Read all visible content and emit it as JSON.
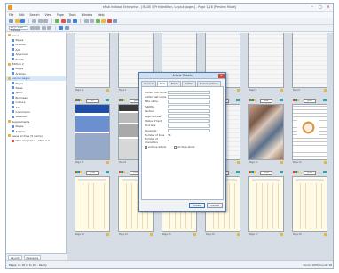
{
  "window": {
    "title": "ePub Inkbook Enterprise - [ISSUE 5 Print edition, Layout pages] - Page 1/16 [Preview Mode]"
  },
  "menu": [
    "File",
    "Edit",
    "Search",
    "View",
    "Page",
    "Tools",
    "Window",
    "Help"
  ],
  "toolbar2": {
    "combo_value": "Page 1/16 - Preview"
  },
  "tree": [
    {
      "level": 0,
      "label": "Issue",
      "icon": "folder",
      "hl": false
    },
    {
      "level": 1,
      "label": "Pages",
      "icon": "doc",
      "hl": false
    },
    {
      "level": 1,
      "label": "Articles",
      "icon": "doc",
      "hl": false
    },
    {
      "level": 1,
      "label": "Ads",
      "icon": "doc",
      "hl": false
    },
    {
      "level": 1,
      "label": "Approved",
      "icon": "doc",
      "hl": false
    },
    {
      "level": 1,
      "label": "Proofs",
      "icon": "doc",
      "hl": false
    },
    {
      "level": 0,
      "label": "Edition 2",
      "icon": "folder",
      "hl": false
    },
    {
      "level": 1,
      "label": "Pages",
      "icon": "doc",
      "hl": false
    },
    {
      "level": 1,
      "label": "Articles",
      "icon": "doc",
      "hl": false
    },
    {
      "level": 0,
      "label": "Layout pages",
      "icon": "folder",
      "hl": true
    },
    {
      "level": 1,
      "label": "Pages",
      "icon": "doc",
      "hl": false
    },
    {
      "level": 1,
      "label": "News",
      "icon": "doc",
      "hl": false
    },
    {
      "level": 1,
      "label": "Sport",
      "icon": "doc",
      "hl": false
    },
    {
      "level": 1,
      "label": "Business",
      "icon": "doc",
      "hl": false
    },
    {
      "level": 1,
      "label": "Culture",
      "icon": "doc",
      "hl": false
    },
    {
      "level": 1,
      "label": "Ads",
      "icon": "doc",
      "hl": false
    },
    {
      "level": 1,
      "label": "Comments",
      "icon": "doc",
      "hl": false
    },
    {
      "level": 1,
      "label": "Weather",
      "icon": "doc",
      "hl": false
    },
    {
      "level": 0,
      "label": "Supplements",
      "icon": "folder",
      "hl": false
    },
    {
      "level": 1,
      "label": "Pages",
      "icon": "doc",
      "hl": false
    },
    {
      "level": 1,
      "label": "Articles",
      "icon": "doc",
      "hl": false
    },
    {
      "level": 0,
      "label": "Issue archive (5 items)",
      "icon": "folder",
      "hl": false
    },
    {
      "level": 1,
      "label": "Web magazine - ePub 2.0",
      "icon": "red",
      "hl": false
    }
  ],
  "leftpanel_tabs": [
    "Layout",
    "Messages"
  ],
  "pages": [
    {
      "col": 0,
      "row": 0,
      "label": "p1",
      "style": "gray",
      "foot": "Page 1"
    },
    {
      "col": 1,
      "row": 0,
      "label": "p2",
      "style": "gray",
      "foot": "Page 2"
    },
    {
      "col": 2,
      "row": 0,
      "label": "p3",
      "style": "gray",
      "foot": "Page 3"
    },
    {
      "col": 3,
      "row": 0,
      "label": "p4",
      "style": "gray",
      "foot": "Page 4"
    },
    {
      "col": 4,
      "row": 0,
      "label": "p5",
      "style": "gray",
      "foot": "Page 5"
    },
    {
      "col": 5,
      "row": 0,
      "label": "p6",
      "style": "gray",
      "foot": "Page 6"
    },
    {
      "col": 0,
      "row": 1,
      "label": "p7",
      "style": "blue",
      "foot": "Page 7"
    },
    {
      "col": 1,
      "row": 1,
      "label": "p8",
      "style": "news",
      "foot": "Page 8"
    },
    {
      "col": 2,
      "row": 1,
      "label": "p9",
      "style": "gray",
      "foot": "Page 9"
    },
    {
      "col": 3,
      "row": 1,
      "label": "p10",
      "style": "gray",
      "foot": "Page 10"
    },
    {
      "col": 4,
      "row": 1,
      "label": "p11",
      "style": "photo",
      "foot": "Page 11"
    },
    {
      "col": 5,
      "row": 1,
      "label": "p12",
      "style": "paper",
      "foot": "Page 12"
    },
    {
      "col": 0,
      "row": 2,
      "label": "p13",
      "style": "cream",
      "foot": "Page 13"
    },
    {
      "col": 1,
      "row": 2,
      "label": "p14",
      "style": "cream",
      "foot": "Page 14"
    },
    {
      "col": 2,
      "row": 2,
      "label": "p15",
      "style": "cream",
      "foot": "Page 15"
    },
    {
      "col": 3,
      "row": 2,
      "label": "p16",
      "style": "cream",
      "foot": "Page 16"
    },
    {
      "col": 4,
      "row": 2,
      "label": "p17",
      "style": "cream",
      "foot": "Page 17"
    },
    {
      "col": 5,
      "row": 2,
      "label": "p18",
      "style": "cream",
      "foot": "Page 18"
    }
  ],
  "dialog": {
    "title": "Article Details",
    "tabs": [
      "General",
      "Text",
      "Notes",
      "Profiles",
      "Picture options"
    ],
    "active_tab": 1,
    "fields": [
      {
        "label": "Author first name",
        "type": "input",
        "value": ""
      },
      {
        "label": "Author last name",
        "type": "input",
        "value": ""
      },
      {
        "label": "Title name",
        "type": "input",
        "value": ""
      },
      {
        "label": "Subtitle",
        "type": "input",
        "value": ""
      },
      {
        "label": "Section",
        "type": "input",
        "value": ""
      },
      {
        "label": "Page number",
        "type": "select",
        "value": ""
      },
      {
        "label": "Status of text",
        "type": "select",
        "value": ""
      },
      {
        "label": "Font size",
        "type": "select",
        "value": ""
      },
      {
        "label": "Keywords",
        "type": "input",
        "value": ""
      },
      {
        "label": "Number of lines",
        "type": "text",
        "value": "34"
      },
      {
        "label": "Number of characters",
        "type": "text",
        "value": "0"
      }
    ],
    "checks": [
      "Archive article",
      "Archive photo"
    ],
    "ok_label": "Close",
    "cancel_label": "Cancel"
  },
  "status": {
    "left": "Pages: 1 - 18 (1 to 18) - Ready",
    "right": "Zoom: 100%   Count: 18"
  }
}
